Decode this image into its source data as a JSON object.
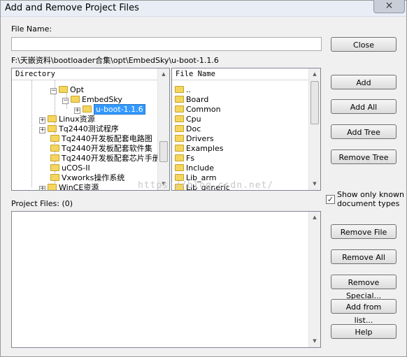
{
  "window": {
    "title": "Add and Remove Project Files",
    "close_glyph": "×"
  },
  "file_name": {
    "label": "File Name:",
    "value": ""
  },
  "current_path": "F:\\天嵌资料\\bootloader合集\\opt\\EmbedSky\\u-boot-1.1.6",
  "directory_panel": {
    "header": "Directory",
    "items": [
      {
        "label": "Opt",
        "expander": "−"
      },
      {
        "label": "EmbedSky",
        "expander": "−"
      },
      {
        "label": "u-boot-1.1.6",
        "expander": "+"
      },
      {
        "label": "Linux资源",
        "expander": "+"
      },
      {
        "label": "Tq2440测试程序",
        "expander": "+"
      },
      {
        "label": "Tq2440开发板配套电路图",
        "expander": ""
      },
      {
        "label": "Tq2440开发板配套软件集",
        "expander": ""
      },
      {
        "label": "Tq2440开发板配套芯片手册",
        "expander": ""
      },
      {
        "label": "uCOS-II",
        "expander": ""
      },
      {
        "label": "Vxworks操作系统",
        "expander": ""
      },
      {
        "label": "WinCE资源",
        "expander": "+"
      }
    ]
  },
  "file_panel": {
    "header": "File Name",
    "items": [
      "..",
      "Board",
      "Common",
      "Cpu",
      "Doc",
      "Drivers",
      "Examples",
      "Fs",
      "Include",
      "Lib_arm",
      "Lib_generic"
    ]
  },
  "buttons": {
    "close": "Close",
    "add": "Add",
    "add_all": "Add All",
    "add_tree": "Add Tree",
    "remove_tree": "Remove Tree",
    "remove_file": "Remove File",
    "remove_all": "Remove All",
    "remove_special": "Remove Special...",
    "add_from_list": "Add from list...",
    "help": "Help"
  },
  "show_known": {
    "label_line1": "Show only known",
    "label_line2": "document types",
    "checked": "✓"
  },
  "project_files": {
    "label": "Project Files: (0)"
  },
  "watermark": "https://blog.csdn.net/",
  "scroll_arrows": {
    "up": "▲",
    "down": "▼"
  },
  "accent_color": "#3399ff"
}
